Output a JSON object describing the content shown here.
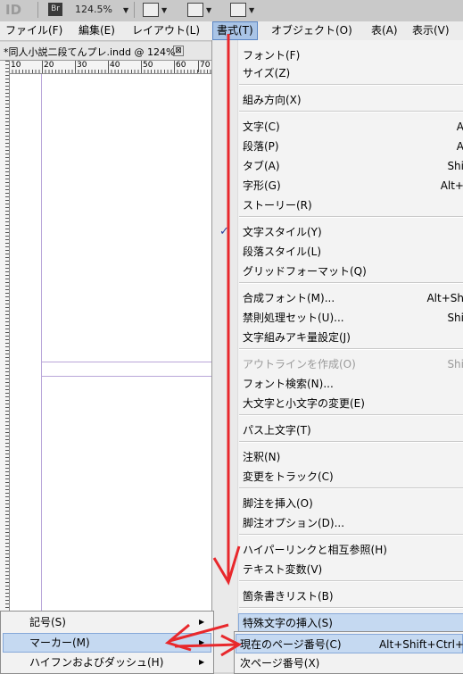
{
  "toolbar": {
    "logo": "ID",
    "bridge": "Br",
    "zoom": "124.5%"
  },
  "menubar": {
    "items": [
      "ファイル(F)",
      "編集(E)",
      "レイアウト(L)",
      "書式(T)",
      "オブジェクト(O)",
      "表(A)",
      "表示(V)"
    ],
    "active_index": 3
  },
  "document": {
    "tab_title": "*同人小説二段てんプレ.indd @ 124%",
    "close": "⊠",
    "ruler_numbers": [
      "10",
      "20",
      "30",
      "40",
      "50",
      "60",
      "70"
    ]
  },
  "menu": {
    "items": [
      {
        "label": "フォント(F)",
        "shortcut": ""
      },
      {
        "label": "サイズ(Z)",
        "shortcut": ""
      },
      {
        "label": "組み方向(X)",
        "shortcut": ""
      },
      {
        "label": "文字(C)",
        "shortcut": "A"
      },
      {
        "label": "段落(P)",
        "shortcut": "A"
      },
      {
        "label": "タブ(A)",
        "shortcut": "Shi"
      },
      {
        "label": "字形(G)",
        "shortcut": "Alt+"
      },
      {
        "label": "ストーリー(R)",
        "shortcut": ""
      },
      {
        "label": "文字スタイル(Y)",
        "shortcut": ""
      },
      {
        "label": "段落スタイル(L)",
        "shortcut": ""
      },
      {
        "label": "グリッドフォーマット(Q)",
        "shortcut": ""
      },
      {
        "label": "合成フォント(M)...",
        "shortcut": "Alt+Sh"
      },
      {
        "label": "禁則処理セット(U)...",
        "shortcut": "Shi"
      },
      {
        "label": "文字組みアキ量設定(J)",
        "shortcut": ""
      },
      {
        "label": "アウトラインを作成(O)",
        "shortcut": "Shi"
      },
      {
        "label": "フォント検索(N)...",
        "shortcut": ""
      },
      {
        "label": "大文字と小文字の変更(E)",
        "shortcut": ""
      },
      {
        "label": "パス上文字(T)",
        "shortcut": ""
      },
      {
        "label": "注釈(N)",
        "shortcut": ""
      },
      {
        "label": "変更をトラック(C)",
        "shortcut": ""
      },
      {
        "label": "脚注を挿入(O)",
        "shortcut": ""
      },
      {
        "label": "脚注オプション(D)...",
        "shortcut": ""
      },
      {
        "label": "ハイパーリンクと相互参照(H)",
        "shortcut": ""
      },
      {
        "label": "テキスト変数(V)",
        "shortcut": ""
      },
      {
        "label": "箇条書きリスト(B)",
        "shortcut": ""
      },
      {
        "label": "特殊文字の挿入(S)",
        "shortcut": ""
      }
    ],
    "checked_label": "✓"
  },
  "submenu1": {
    "items": [
      "記号(S)",
      "マーカー(M)",
      "ハイフンおよびダッシュ(H)"
    ],
    "arrow": "▶"
  },
  "submenu2": {
    "items": [
      {
        "label": "現在のページ番号(C)",
        "shortcut": "Alt+Shift+Ctrl+"
      },
      {
        "label": "次ページ番号(X)",
        "shortcut": ""
      }
    ]
  },
  "colors": {
    "annotation": "#e8282c",
    "highlight": "#c5d9f1",
    "guide": "#b9a6d9"
  }
}
